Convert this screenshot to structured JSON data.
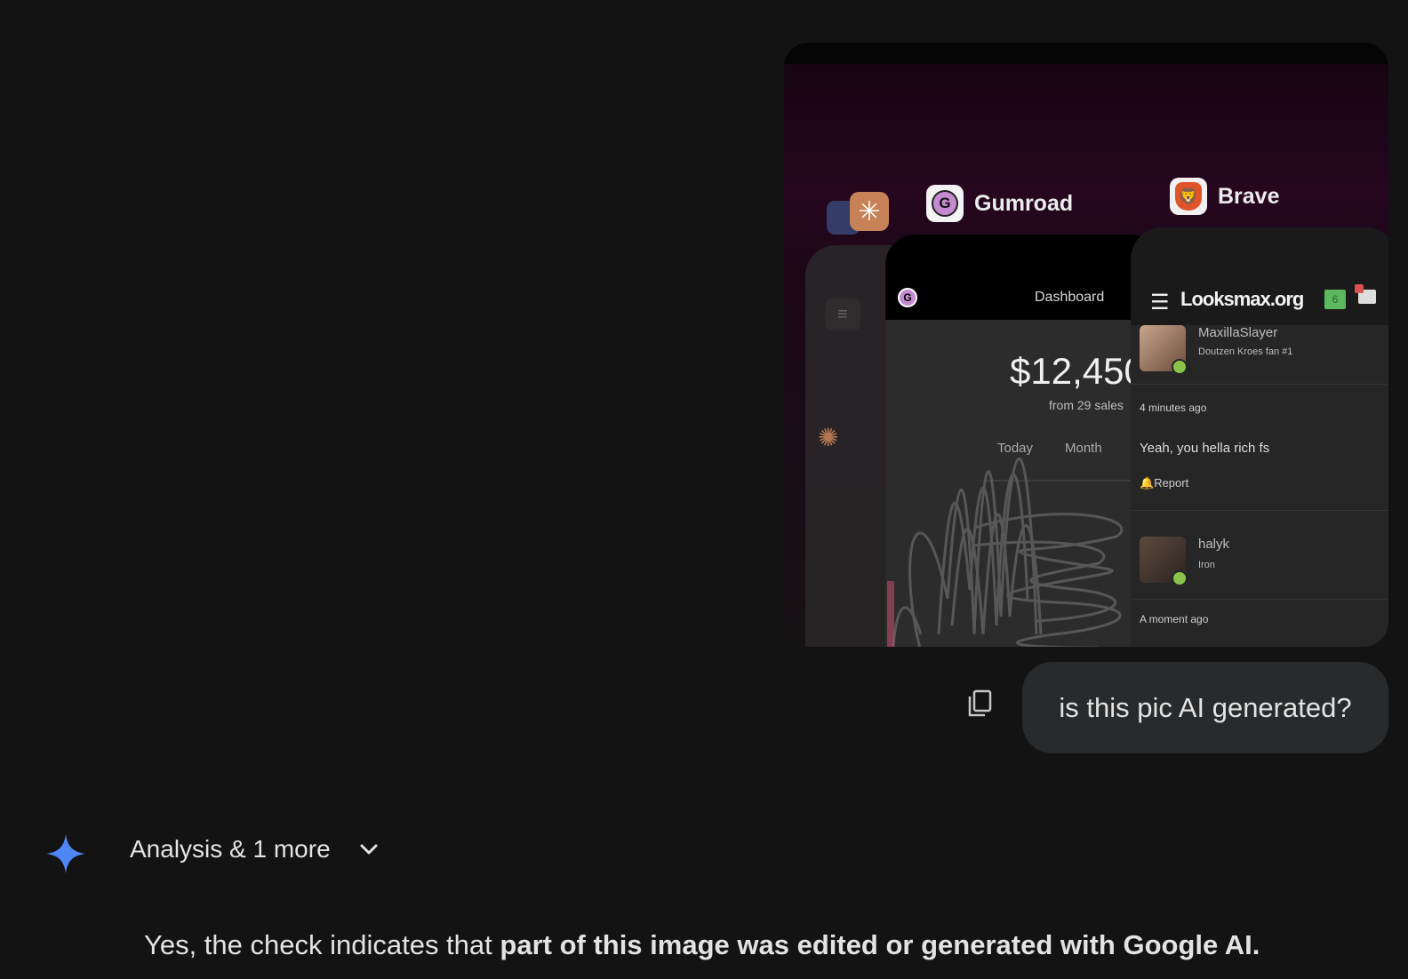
{
  "attachment": {
    "apps": {
      "gumroad": {
        "label": "Gumroad",
        "icon_letter": "G"
      },
      "brave": {
        "label": "Brave",
        "icon": "brave-lion-icon"
      }
    },
    "gumroad_card": {
      "header_label": "Dashboard",
      "logo_letter": "G",
      "amount": "$12,450",
      "sales_note": "from 29 sales",
      "tab_today": "Today",
      "tab_month": "Month"
    },
    "brave_card": {
      "site_logo": "Looksmax.org",
      "badge_count": "6",
      "posts": [
        {
          "username": "MaxillaSlayer",
          "user_title": "Doutzen Kroes fan #1",
          "time": "4 minutes ago",
          "message": "Yeah, you hella rich fs",
          "report": "Report"
        },
        {
          "username": "halyk",
          "user_title": "Iron",
          "time": "A moment ago"
        }
      ]
    }
  },
  "user_prompt": {
    "text": "is this pic AI generated?"
  },
  "response": {
    "toggle_label": "Analysis & 1 more",
    "text_plain": "Yes, the check indicates that ",
    "text_bold": "part of this image was edited or generated with Google AI."
  },
  "colors": {
    "background": "#131314",
    "bubble": "#282a2c",
    "gemini_blue": "#4e86f5"
  }
}
